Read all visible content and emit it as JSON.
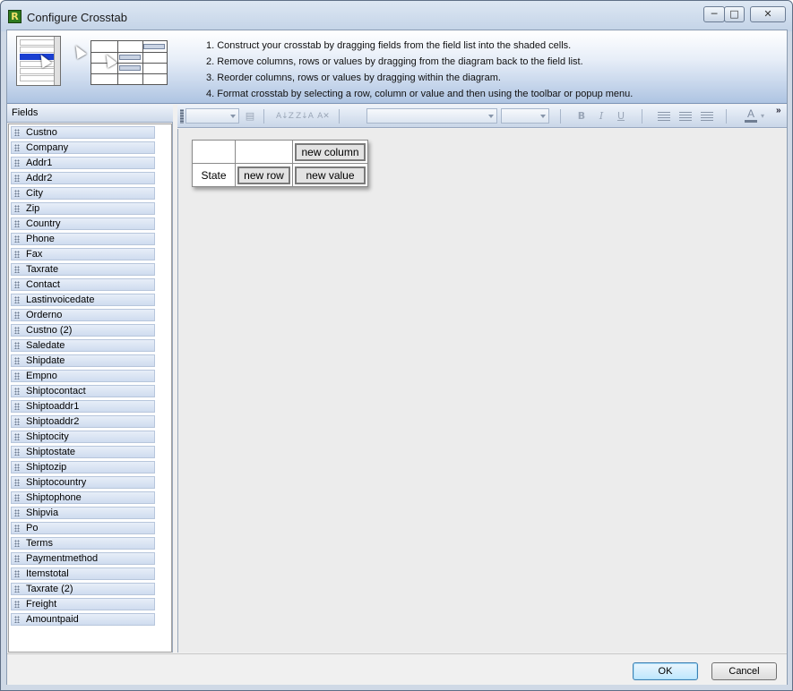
{
  "window": {
    "title": "Configure Crosstab",
    "icon_letter": "R",
    "controls": {
      "minimize": "─",
      "maximize": "□",
      "close": "✕"
    }
  },
  "banner": {
    "instructions": [
      "1. Construct your crosstab by dragging fields from the field list into the shaded cells.",
      "2. Remove columns, rows or values by dragging from the diagram back to the field list.",
      "3. Reorder columns, rows or values by dragging within the diagram.",
      "4. Format crosstab by selecting a row, column or value and then using the toolbar or popup menu."
    ]
  },
  "fields": {
    "header": "Fields",
    "items": [
      "Custno",
      "Company",
      "Addr1",
      "Addr2",
      "City",
      "Zip",
      "Country",
      "Phone",
      "Fax",
      "Taxrate",
      "Contact",
      "Lastinvoicedate",
      "Orderno",
      "Custno (2)",
      "Saledate",
      "Shipdate",
      "Empno",
      "Shiptocontact",
      "Shiptoaddr1",
      "Shiptoaddr2",
      "Shiptocity",
      "Shiptostate",
      "Shiptozip",
      "Shiptocountry",
      "Shiptophone",
      "Shipvia",
      "Po",
      "Terms",
      "Paymentmethod",
      "Itemstotal",
      "Taxrate (2)",
      "Freight",
      "Amountpaid"
    ]
  },
  "toolbar": {
    "font_name": "",
    "font_size": "",
    "style_value": "",
    "size_value": "",
    "buttons": {
      "sort_asc": "A↓Z",
      "sort_desc": "Z↓A",
      "clear_sort": "A✕",
      "bold": "B",
      "italic": "I",
      "underline": "U",
      "font_color": "A",
      "more": "»"
    },
    "icons": [
      "properties-icon",
      "sort-ascending-icon",
      "sort-descending-icon",
      "clear-sort-icon",
      "bold-icon",
      "italic-icon",
      "underline-icon",
      "align-left-icon",
      "align-center-icon",
      "align-right-icon",
      "font-color-icon",
      "toolbar-overflow-icon"
    ]
  },
  "crosstab": {
    "new_column": "new column",
    "row_header": "State",
    "new_row": "new row",
    "new_value": "new value"
  },
  "buttons": {
    "ok": "OK",
    "cancel": "Cancel"
  }
}
